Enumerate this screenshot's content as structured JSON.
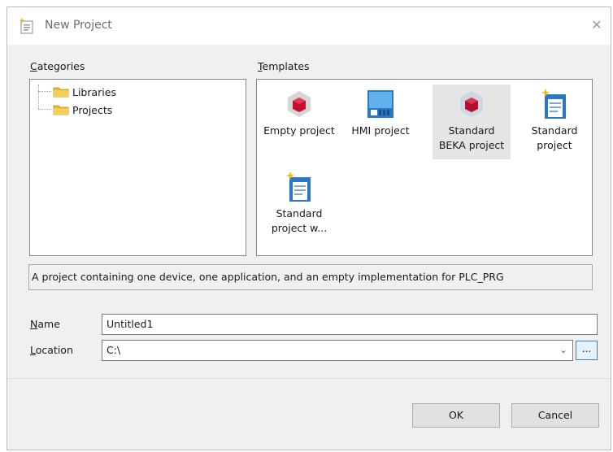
{
  "dialog": {
    "title": "New Project",
    "close_label": "✕"
  },
  "categories": {
    "label_accel": "C",
    "label_rest": "ategories",
    "items": [
      {
        "label": "Libraries"
      },
      {
        "label": "Projects"
      }
    ]
  },
  "templates": {
    "label_accel": "T",
    "label_rest": "emplates",
    "items": [
      {
        "label": "Empty project",
        "icon": "empty-project-icon"
      },
      {
        "label": "HMI project",
        "icon": "hmi-project-icon"
      },
      {
        "label": "Standard\nBEKA project",
        "icon": "beka-project-icon"
      },
      {
        "label": "Standard\nproject",
        "icon": "standard-project-icon"
      },
      {
        "label": "Standard\nproject w...",
        "icon": "standard-project-with-icon"
      }
    ]
  },
  "description": "A project containing one device, one application, and an empty implementation for PLC_PRG",
  "name_field": {
    "label_accel": "N",
    "label_rest": "ame",
    "value": "Untitled1"
  },
  "location_field": {
    "label_accel": "L",
    "label_rest": "ocation",
    "value": "C:\\",
    "browse_label": "..."
  },
  "buttons": {
    "ok": "OK",
    "cancel": "Cancel"
  },
  "colors": {
    "accent": "#3c7fb1",
    "selected_bg": "#e5e5e5",
    "cube_red": "#c8102e"
  }
}
